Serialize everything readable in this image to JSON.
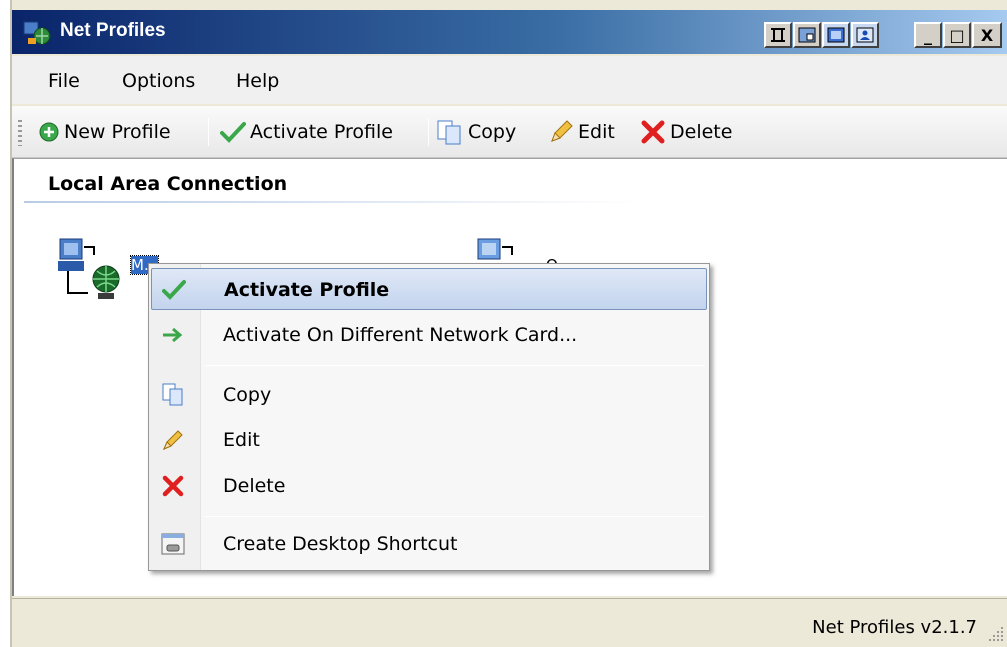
{
  "window": {
    "title": "Net Profiles"
  },
  "titlebar_buttons": {
    "minimize_label": "_",
    "maximize_label": "□",
    "close_label": "X"
  },
  "menubar": {
    "items": [
      "File",
      "Options",
      "Help"
    ]
  },
  "toolbar": {
    "new_profile": "New Profile",
    "activate_profile": "Activate Profile",
    "copy": "Copy",
    "edit": "Edit",
    "delete": "Delete"
  },
  "content": {
    "section_title": "Local Area Connection",
    "profiles": [
      {
        "label": "M...",
        "selected": true
      },
      {
        "label": "O...",
        "selected": false
      }
    ]
  },
  "context_menu": {
    "items": [
      {
        "label": "Activate Profile",
        "icon": "check-icon",
        "highlighted": true
      },
      {
        "label": "Activate On Different Network Card...",
        "icon": "arrow-right-icon"
      },
      {
        "label": "Copy",
        "icon": "copy-icon"
      },
      {
        "label": "Edit",
        "icon": "pencil-icon"
      },
      {
        "label": "Delete",
        "icon": "delete-x-icon"
      },
      {
        "label": "Create Desktop Shortcut",
        "icon": "shortcut-icon"
      }
    ]
  },
  "statusbar": {
    "text": "Net Profiles v2.1.7"
  },
  "colors": {
    "titlebar_start": "#0a246a",
    "titlebar_end": "#a6caf0",
    "highlight": "#c3d4ee",
    "selection": "#316ac5"
  }
}
